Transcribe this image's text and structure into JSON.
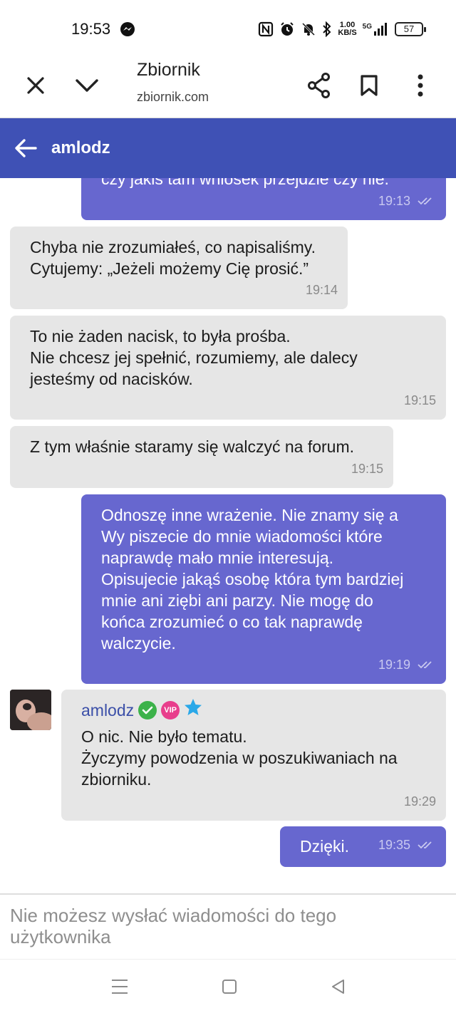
{
  "status_bar": {
    "time": "19:53",
    "speed_value": "1.00",
    "speed_unit": "KB/S",
    "network": "5G",
    "battery": "57",
    "icons": [
      "messenger-icon",
      "nfc-icon",
      "alarm-icon",
      "mute-icon",
      "bluetooth-icon",
      "signal-icon"
    ]
  },
  "browser": {
    "title": "Zbiornik",
    "url": "zbiornik.com",
    "icons": [
      "close-icon",
      "chevron-down-icon",
      "share-icon",
      "bookmark-icon",
      "more-icon"
    ]
  },
  "header": {
    "title": "amlodz",
    "accent": "#3f51b5"
  },
  "messages": [
    {
      "dir": "out",
      "text": "czy jakiś tam wniosek przejdzie czy nie.",
      "time": "19:13"
    },
    {
      "dir": "in",
      "text": "Chyba nie zrozumiałeś, co napisaliśmy.\nCytujemy: „Jeżeli możemy Cię prosić.”",
      "time": "19:14"
    },
    {
      "dir": "in",
      "text": "To nie żaden nacisk, to była prośba.\nNie chcesz jej spełnić, rozumiemy, ale dalecy\njesteśmy od nacisków.",
      "time": "19:15"
    },
    {
      "dir": "in",
      "text": "Z tym właśnie staramy się walczyć na forum.",
      "time": "19:15"
    },
    {
      "dir": "out",
      "text": "Odnoszę inne wrażenie. Nie znamy się a\nWy piszecie do mnie wiadomości które\nnaprawdę mało mnie interesują.\nOpisujecie jakąś osobę która tym bardziej\nmnie ani ziębi ani parzy. Nie mogę do\nkońca zrozumieć o co tak naprawdę\nwalczycie.",
      "time": "19:19"
    },
    {
      "dir": "in",
      "sender": "amlodz",
      "badge_vip": "VIP",
      "text": "O nic. Nie było tematu.\nŻyczymy powodzenia w poszukiwaniach na\nzbiorniku.",
      "time": "19:29"
    },
    {
      "dir": "out",
      "text": "Dzięki.",
      "time": "19:35"
    }
  ],
  "composer": {
    "disabled_text": "Nie możesz wysłać wiadomości do tego użytkownika"
  },
  "colors": {
    "outgoing_bubble": "#6767cf",
    "incoming_bubble": "#e6e6e6",
    "sender_name": "#3b4fa8"
  }
}
